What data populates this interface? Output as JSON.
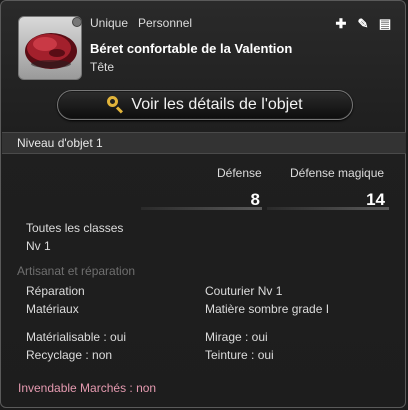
{
  "header": {
    "rarity": "Unique",
    "binding": "Personnel",
    "item_name": "Béret confortable de la Valention",
    "slot": "Tête",
    "icons": [
      "plus-icon",
      "gear-tag-icon",
      "inventory-icon"
    ]
  },
  "actions": {
    "view_details": "Voir les détails de l'objet"
  },
  "item_level": "Niveau d'objet 1",
  "stats": {
    "defense_label": "Défense",
    "defense_value": "8",
    "magic_defense_label": "Défense magique",
    "magic_defense_value": "14"
  },
  "classes": {
    "label": "Toutes les classes",
    "level": "Nv 1"
  },
  "crafting": {
    "section_title": "Artisanat et réparation",
    "repair_label": "Réparation",
    "repair_value": "Couturier Nv 1",
    "materials_label": "Matériaux",
    "materials_value": "Matière sombre grade I",
    "materialize": "Matérialisable : oui",
    "glamour": "Mirage : oui",
    "desynth": "Recyclage : non",
    "dye": "Teinture : oui"
  },
  "market": "Invendable Marchés : non",
  "colors": {
    "accent_gold": "#e2b43a",
    "untradable_pink": "#e59ab0"
  }
}
